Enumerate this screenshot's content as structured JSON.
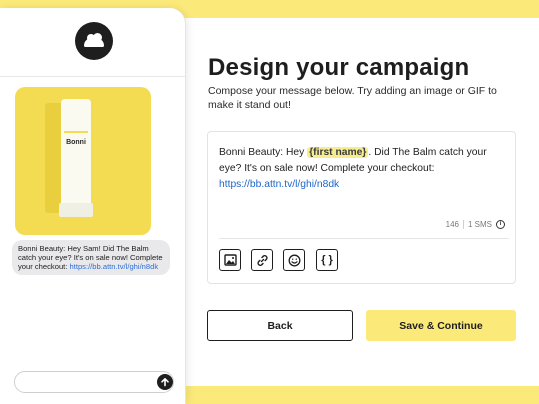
{
  "preview": {
    "product_label": "Bonni",
    "bubble_text": "Bonni Beauty: Hey Sam! Did The Balm catch your eye? It's on sale now! Complete your checkout: ",
    "bubble_link": "https://bb.attn.tv/l/ghi/n8dk",
    "input_placeholder": ""
  },
  "campaign": {
    "title": "Design your campaign",
    "subtitle": "Compose your message below. Try adding an image or GIF to make it stand out!"
  },
  "editor": {
    "message_prefix": "Bonni Beauty: Hey ",
    "token": "{first name}",
    "message_suffix": ". Did The Balm catch your eye? It's on sale now! Complete your checkout:",
    "link": "https://bb.attn.tv/l/ghi/n8dk",
    "char_count": "146",
    "sms_count": "1 SMS",
    "variable_tool_label": "{ }"
  },
  "actions": {
    "back_label": "Back",
    "save_label": "Save & Continue"
  },
  "colors": {
    "brand_yellow": "#fbe97a",
    "link_blue": "#1d66c8",
    "token_highlight": "#f5ed8e"
  },
  "icons": {
    "image_tool": "image-icon",
    "link_tool": "link-icon",
    "emoji_tool": "emoji-icon",
    "variable_tool": "braces-icon",
    "send": "arrow-up-icon",
    "info": "info-icon"
  }
}
